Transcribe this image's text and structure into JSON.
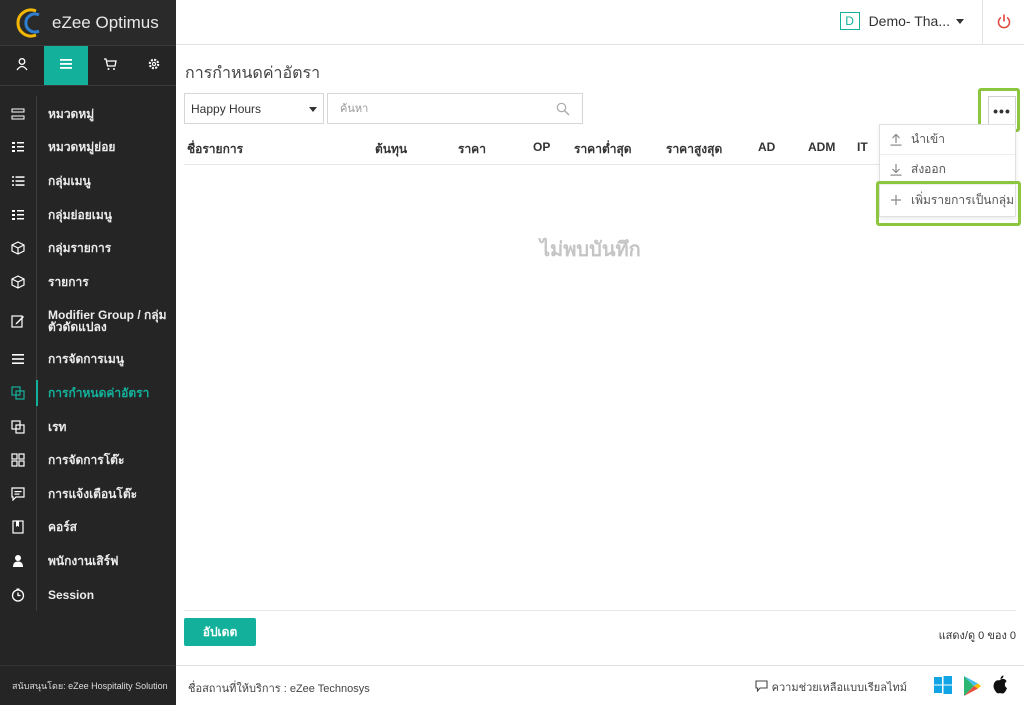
{
  "app": {
    "name": "eZee Optimus",
    "sponsor": "สนับสนุนโดย: eZee Hospitality Solution"
  },
  "header": {
    "property_badge": "D",
    "property_name": "Demo- Tha..."
  },
  "sidebar": {
    "tabs": [
      {
        "icon": "user-icon"
      },
      {
        "icon": "menu-icon",
        "active": true
      },
      {
        "icon": "cart-icon"
      },
      {
        "icon": "gear-icon"
      }
    ],
    "items": [
      {
        "label": "หมวดหมู่",
        "icon": "category-icon"
      },
      {
        "label": "หมวดหมู่ย่อย",
        "icon": "subcategory-icon"
      },
      {
        "label": "กลุ่มเมนู",
        "icon": "list-icon"
      },
      {
        "label": "กลุ่มย่อยเมนู",
        "icon": "sublist-icon"
      },
      {
        "label": "กลุ่มรายการ",
        "icon": "box-icon"
      },
      {
        "label": "รายการ",
        "icon": "box-icon"
      },
      {
        "label": "Modifier Group / กลุ่มตัวดัดแปลง",
        "icon": "edit-icon"
      },
      {
        "label": "การจัดการเมนู",
        "icon": "hamburger-icon"
      },
      {
        "label": "การกำหนดค่าอัตรา",
        "icon": "copy-icon",
        "active": true
      },
      {
        "label": "เรท",
        "icon": "copy-icon"
      },
      {
        "label": "การจัดการโต๊ะ",
        "icon": "grid-icon"
      },
      {
        "label": "การแจ้งเตือนโต๊ะ",
        "icon": "chat-icon"
      },
      {
        "label": "คอร์ส",
        "icon": "book-icon"
      },
      {
        "label": "พนักงานเสิร์ฟ",
        "icon": "person-icon"
      },
      {
        "label": "Session",
        "icon": "clock-icon"
      }
    ]
  },
  "main": {
    "title": "การกำหนดค่าอัตรา",
    "filter_select": "Happy Hours",
    "search_placeholder": "ค้นหา",
    "more_label": "•••",
    "columns": [
      "ชื่อรายการ",
      "ต้นทุน",
      "ราคา",
      "OP",
      "ราคาต่ำสุด",
      "ราคาสูงสุด",
      "AD",
      "ADM",
      "IT"
    ],
    "empty_text": "ไม่พบบันทึก",
    "dropdown": [
      {
        "label": "นำเข้า",
        "icon": "upload-icon"
      },
      {
        "label": "ส่งออก",
        "icon": "download-icon"
      },
      {
        "label": "เพิ่มรายการเป็นกลุ่ม",
        "icon": "plus-icon"
      }
    ],
    "update_button": "อัปเดต",
    "paging": "แสดง/ดู 0 ของ 0"
  },
  "footer": {
    "service_name": "ชื่อสถานที่ให้บริการ : eZee Technosys",
    "help": "ความช่วยเหลือแบบเรียลไทม์"
  },
  "colors": {
    "accent": "#13b19b",
    "highlight": "#8cc63f",
    "sidebar_bg": "#252525",
    "power": "#e0433a"
  }
}
